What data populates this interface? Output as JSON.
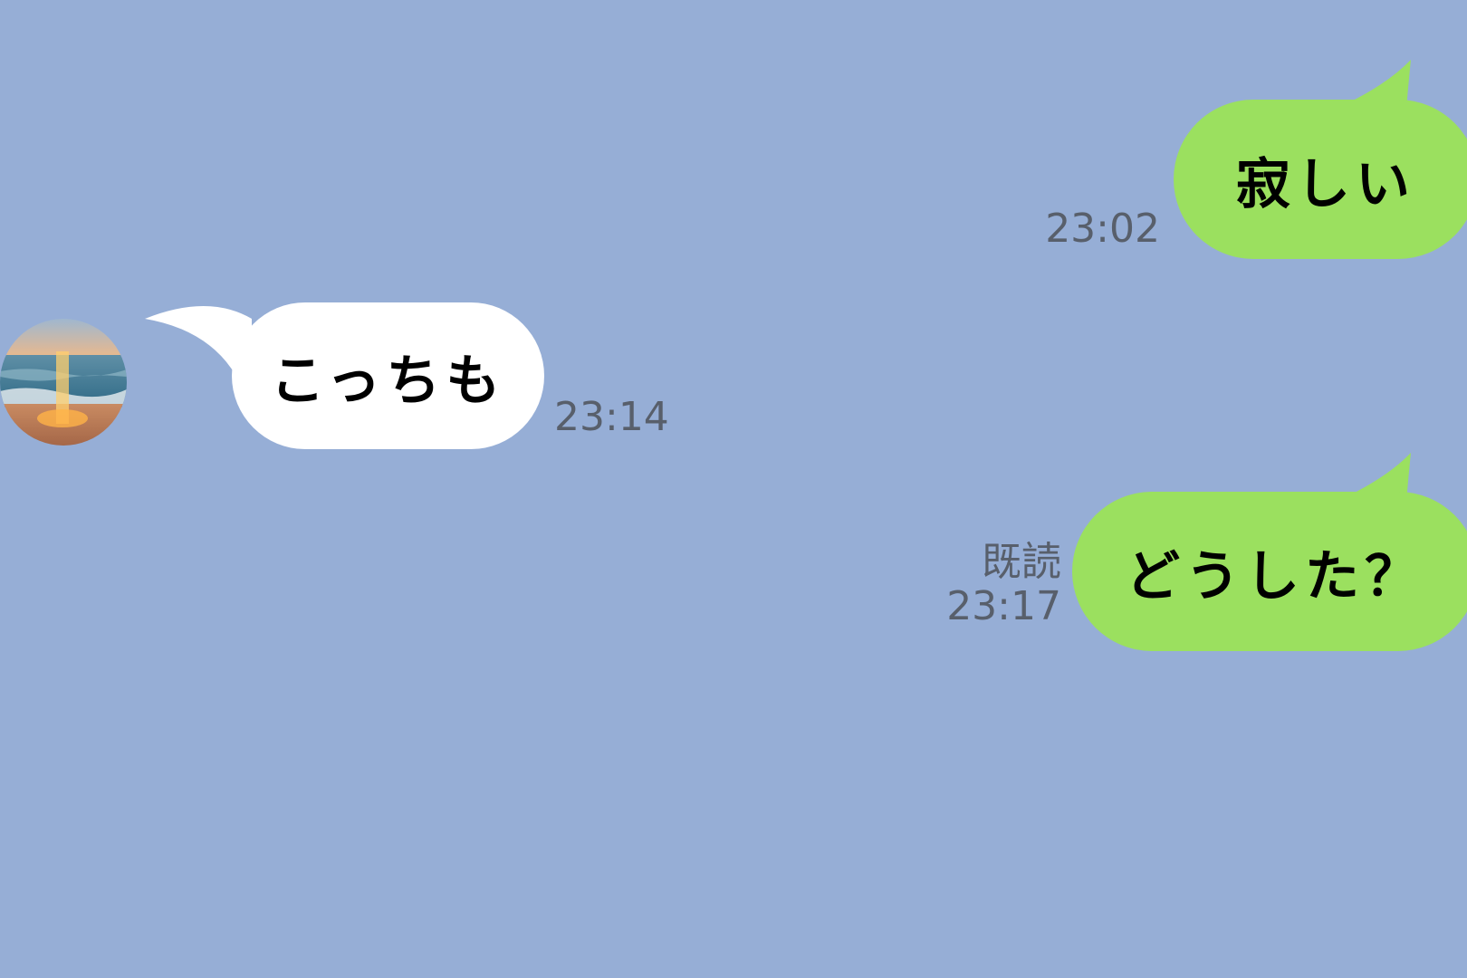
{
  "chat": {
    "background_color": "#96aed6",
    "sent_bubble_color": "#9be05f",
    "received_bubble_color": "#ffffff",
    "messages": [
      {
        "direction": "sent",
        "text": "寂しい",
        "time": "23:02",
        "read": ""
      },
      {
        "direction": "received",
        "text": "こっちも",
        "time": "23:14",
        "avatar": "sunset-ocean-avatar"
      },
      {
        "direction": "sent",
        "text": "どうした？",
        "time": "23:17",
        "read": "既読"
      }
    ]
  }
}
